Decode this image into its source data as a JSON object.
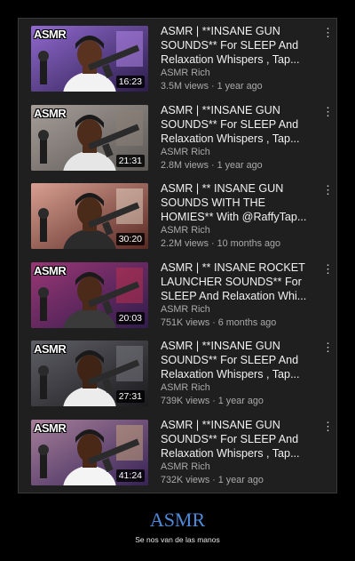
{
  "videos": [
    {
      "title": "ASMR | **INSANE GUN SOUNDS**  For SLEEP And Relaxation Whispers , Tap...",
      "channel": "ASMR Rich",
      "meta": "3.5M views · 1 year ago",
      "duration": "16:23",
      "logo": "ASMR",
      "colors": {
        "bg": "#5f3fa6",
        "accent": "#b88cf0",
        "skin": "#5a3320",
        "shirt": "#f2f2f2"
      }
    },
    {
      "title": "ASMR | **INSANE GUN SOUNDS**  For SLEEP And Relaxation Whispers , Tap...",
      "channel": "ASMR Rich",
      "meta": "2.8M views · 1 year ago",
      "duration": "21:31",
      "logo": "ASMR",
      "colors": {
        "bg": "#c9c2bd",
        "accent": "#8b7f78",
        "skin": "#4e2c1b",
        "shirt": "#e6e6e6"
      }
    },
    {
      "title": "ASMR | ** INSANE GUN SOUNDS WITH THE HOMIES** With @RaffyTap...",
      "channel": "ASMR Rich",
      "meta": "2.2M views · 10 months ago",
      "duration": "30:20",
      "logo": "",
      "colors": {
        "bg": "#c45a4e",
        "accent": "#e8d8c8",
        "skin": "#4a2a18",
        "shirt": "#2b2b2b"
      }
    },
    {
      "title": "ASMR | ** INSANE ROCKET LAUNCHER SOUNDS** For SLEEP And Relaxation Whi...",
      "channel": "ASMR Rich",
      "meta": "751K views · 6 months ago",
      "duration": "20:03",
      "logo": "ASMR",
      "colors": {
        "bg": "#6a3fa8",
        "accent": "#c12f4a",
        "skin": "#4b2a19",
        "shirt": "#3a3a3a"
      }
    },
    {
      "title": "ASMR | **INSANE GUN SOUNDS**  For SLEEP And Relaxation Whispers , Tap...",
      "channel": "ASMR Rich",
      "meta": "739K views · 1 year ago",
      "duration": "27:31",
      "logo": "ASMR",
      "colors": {
        "bg": "#3a3a40",
        "accent": "#7d7d86",
        "skin": "#3f2416",
        "shirt": "#ececec"
      }
    },
    {
      "title": "ASMR | **INSANE GUN SOUNDS**  For SLEEP And Relaxation Whispers , Tap...",
      "channel": "ASMR Rich",
      "meta": "732K views · 1 year ago",
      "duration": "41:24",
      "logo": "ASMR",
      "colors": {
        "bg": "#7a4cc0",
        "accent": "#c9a87a",
        "skin": "#4a2818",
        "shirt": "#f4f4f4"
      }
    }
  ],
  "more_icon": "more-vert-icon",
  "caption": {
    "title": "ASMR",
    "subtitle": "Se nos van de las manos"
  }
}
